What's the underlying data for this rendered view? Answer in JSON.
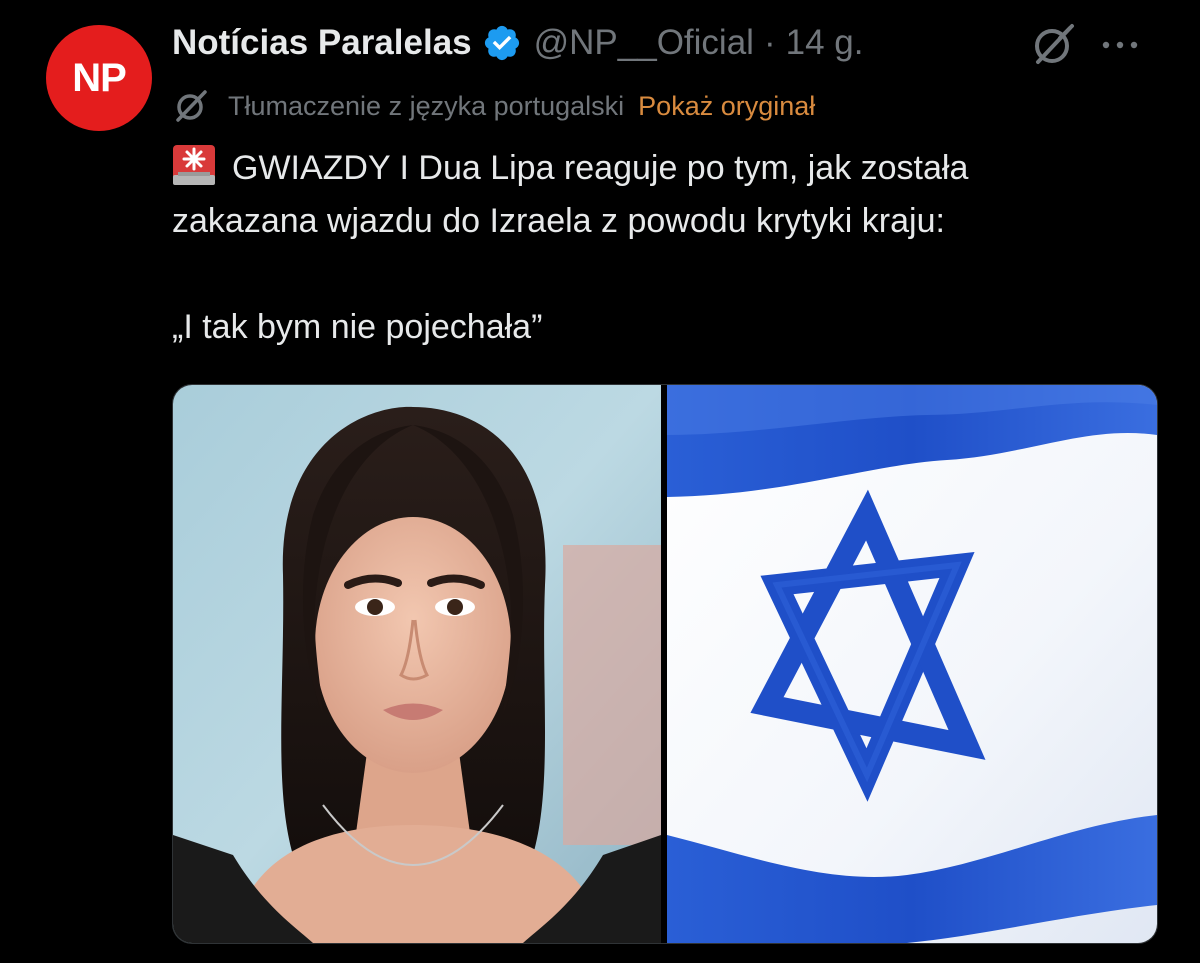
{
  "post": {
    "avatar_text": "NP",
    "display_name": "Notícias Paralelas",
    "handle": "@NP__Oficial",
    "separator": "·",
    "time": "14 g.",
    "translation_label": "Tłumaczenie z języka portugalski",
    "show_original_label": "Pokaż oryginał",
    "text_line_1": "GWIAZDY I Dua Lipa reaguje po tym, jak została",
    "text_line_2": "zakazana wjazdu do Izraela z powodu krytyki kraju:",
    "text_line_3": "„I tak bym nie pojechała”"
  },
  "icons": {
    "avatar": "np-logo",
    "verified": "verified-badge-icon",
    "grok": "grok-icon",
    "more": "more-horizontal-icon",
    "translate": "translate-icon",
    "siren": "rotating-light-emoji"
  },
  "colors": {
    "background": "#000000",
    "text_primary": "#e7e9ea",
    "text_secondary": "#71767b",
    "accent_link": "#d98b3f",
    "avatar_bg": "#e41d1d",
    "verified_blue": "#1d9bf0",
    "flag_blue": "#1f4fc8"
  }
}
